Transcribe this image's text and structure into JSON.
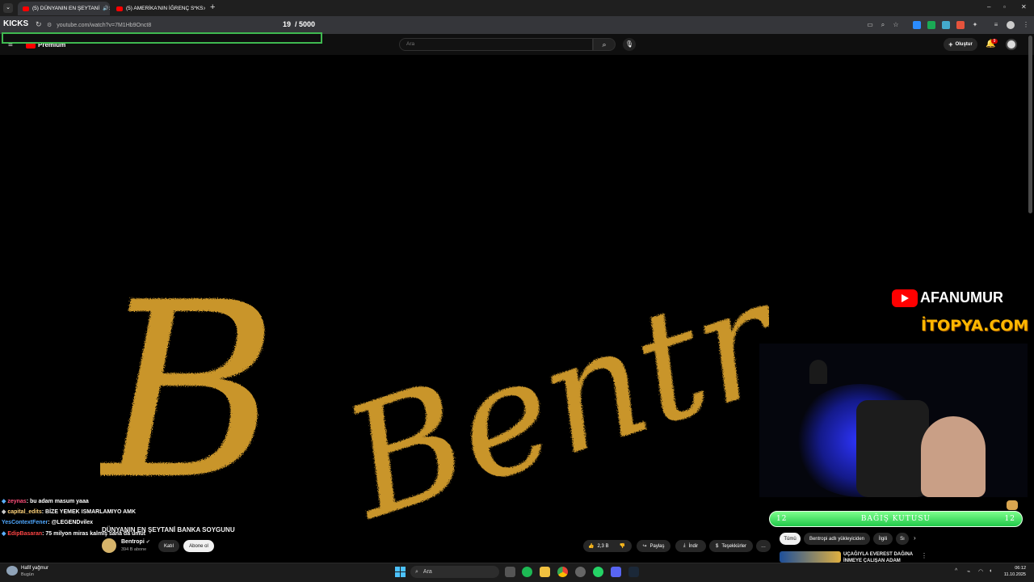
{
  "tabs": [
    {
      "title": "(5) DÜNYANIN EN ŞEYTANİ",
      "close": "×",
      "active": true
    },
    {
      "title": "(5) AMERİKA'NIN İĞRENÇ S*KS",
      "close": "×",
      "active": false
    }
  ],
  "new_tab": "+",
  "window_controls": {
    "minimize": "–",
    "maximize": "▫",
    "close": "✕"
  },
  "kicks": {
    "label": "KICKS",
    "count": "19",
    "total": "/ 5000"
  },
  "url": "youtube.com/watch?v=7M1Hb9Onct8",
  "youtube": {
    "logo_text": "Premium",
    "search_placeholder": "Ara",
    "create_label": "Oluştur",
    "notification_count": "9"
  },
  "overlay": {
    "brand_name": "AFANUMUR",
    "site_name": "İTOPYA.COM",
    "donation_label": "BAĞIŞ KUTUSU",
    "donation_left": "12",
    "donation_right": "12"
  },
  "video": {
    "title_art": "Bentropi"
  },
  "chat": [
    {
      "user": "zeynas",
      "message": ": bu adam masum yaaa",
      "color": "#ff4f7a"
    },
    {
      "user": "capital_edits",
      "message": ": BİZE YEMEK ISMARLAMIYO AMK",
      "color": "#ffd37a"
    },
    {
      "user": "YesContextFener",
      "message": ": @LEGENDvilex",
      "color": "#4fa8ff"
    },
    {
      "user": "EdipBasaran",
      "message": ": 75 milyon miras kalmış sana da umut",
      "color": "#ff4545"
    }
  ],
  "video_title": "DÜNYANIN EN ŞEYTANİ BANKA SOYGUNU",
  "channel": {
    "name": "Bentropi",
    "subscribers": "394 B abone",
    "join": "Katıl",
    "subscribe": "Abone ol"
  },
  "actions": {
    "likes": "2,3 B",
    "share": "Paylaş",
    "download": "İndir",
    "thanks": "Teşekkürler",
    "more": "…"
  },
  "filters": [
    "Tümü",
    "Bentropi adlı yükleyiciden",
    "İlgili",
    "Sı"
  ],
  "recommended": {
    "title_line1": "UÇAĞIYLA EVEREST DAĞINA",
    "title_line2": "İNMEYE ÇALIŞAN ADAM"
  },
  "weather": {
    "title": "Hafif yağmur",
    "subtitle": "Bugün"
  },
  "taskbar": {
    "search_placeholder": "Ara",
    "time": "06:12",
    "date": "11.10.2025"
  }
}
